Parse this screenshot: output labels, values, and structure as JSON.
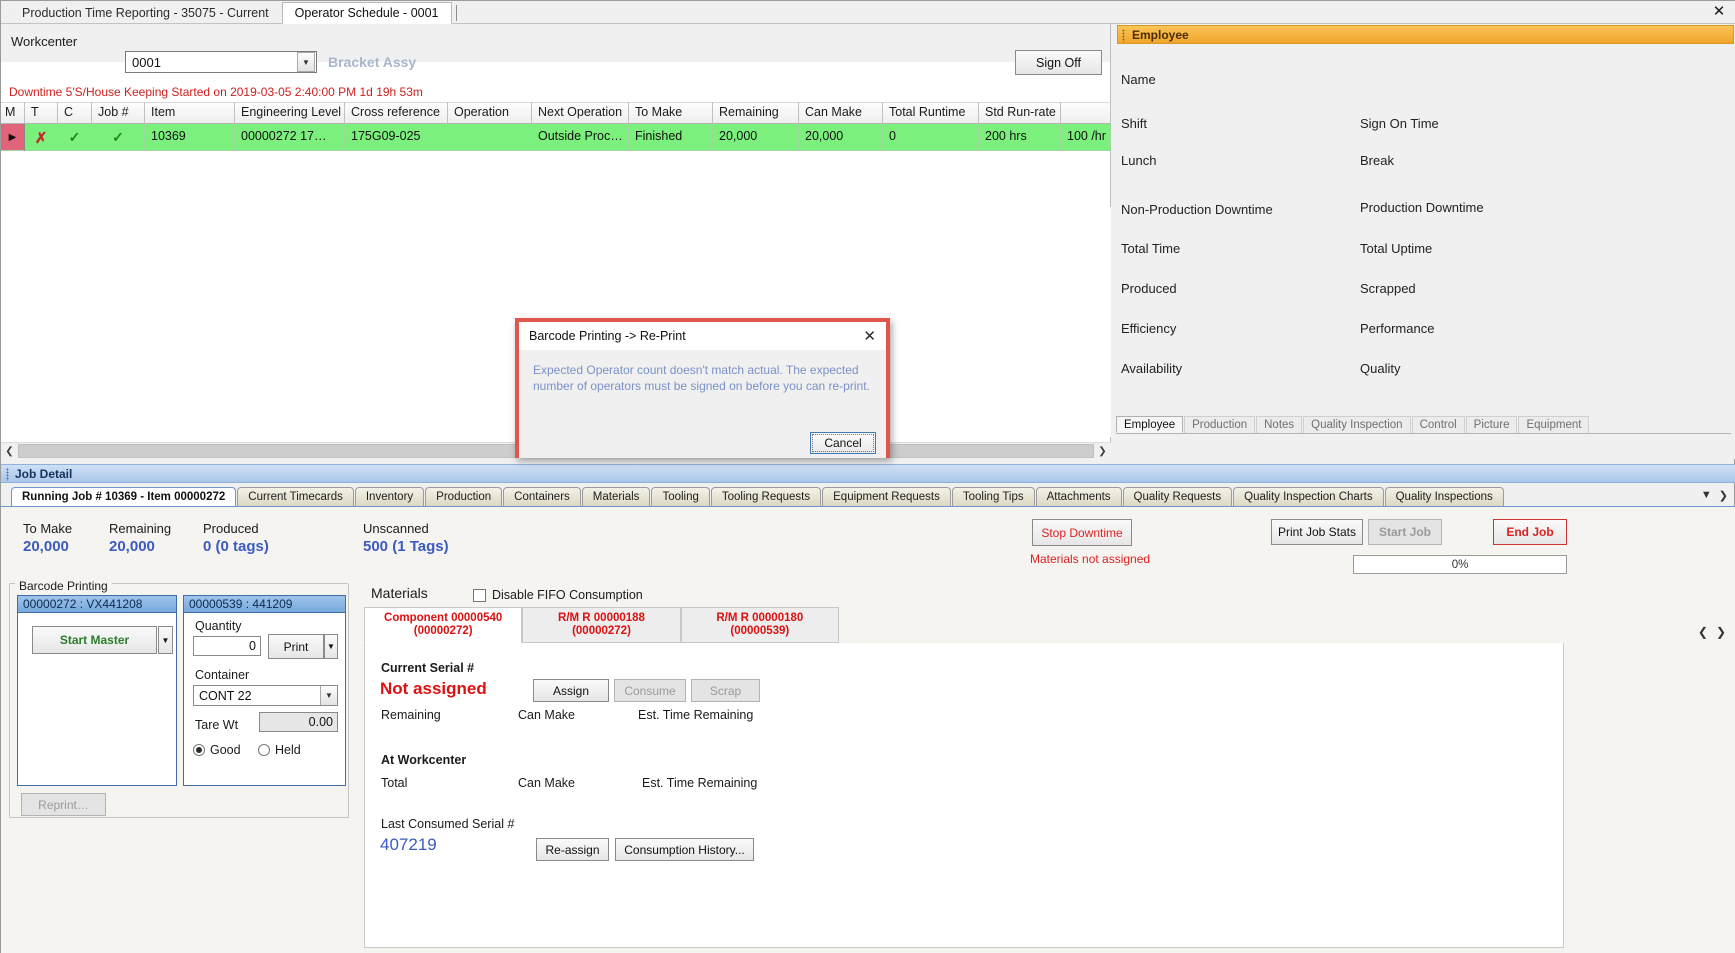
{
  "window": {
    "close_icon": "close-icon",
    "tabs": [
      {
        "label": "Production Time Reporting - 35075 - Current",
        "active": false
      },
      {
        "label": "Operator Schedule - 0001",
        "active": true
      }
    ]
  },
  "workcenter": {
    "label": "Workcenter",
    "value": "0001",
    "description": "Bracket Assy",
    "sign_off_label": "Sign Off",
    "downtime_message": "Downtime 5'S/House Keeping Started on 2019-03-05 2:40:00 PM 1d 19h 53m"
  },
  "schedule_grid": {
    "columns": [
      "M",
      "T",
      "C",
      "Job #",
      "Item",
      "Engineering Level",
      "Cross reference",
      "Operation",
      "Next Operation",
      "To Make",
      "Remaining",
      "Can Make",
      "Total Runtime",
      "Std Run-rate"
    ],
    "rows": [
      {
        "selected": true,
        "m": "x-icon",
        "t": "check-icon",
        "c": "check-icon",
        "job": "10369",
        "item": "00000272  17…",
        "engineering_level": "175G09-025",
        "cross_reference": "",
        "operation": "Outside  Proc…",
        "next_operation": "Finished",
        "to_make": "20,000",
        "remaining": "20,000",
        "can_make": "0",
        "total_runtime": "200 hrs",
        "std_run_rate": "100 /hr"
      }
    ]
  },
  "employee_panel": {
    "header": "Employee",
    "fields_left": [
      "Name",
      "Shift",
      "Lunch",
      "Non-Production Downtime",
      "Total Time",
      "Produced",
      "Efficiency",
      "Availability"
    ],
    "fields_right": [
      "Sign On Time",
      "Break",
      "Production Downtime",
      "Total Uptime",
      "Scrapped",
      "Performance",
      "Quality"
    ],
    "tabs": [
      {
        "label": "Employee",
        "active": true
      },
      {
        "label": "Production",
        "active": false
      },
      {
        "label": "Notes",
        "active": false
      },
      {
        "label": "Quality Inspection",
        "active": false
      },
      {
        "label": "Control",
        "active": false
      },
      {
        "label": "Picture",
        "active": false
      },
      {
        "label": "Equipment",
        "active": false
      }
    ]
  },
  "dialog": {
    "title": "Barcode Printing -> Re-Print",
    "close_icon": "close-icon",
    "message": "Expected Operator count doesn't match actual. The expected number of operators must be signed on before you can re-print.",
    "cancel_label": "Cancel",
    "border_color": "#e0564d"
  },
  "job_detail": {
    "section_title": "Job Detail",
    "tabs": [
      {
        "label": "Running Job # 10369 - Item 00000272",
        "active": true
      },
      {
        "label": "Current Timecards",
        "active": false
      },
      {
        "label": "Inventory",
        "active": false
      },
      {
        "label": "Production",
        "active": false
      },
      {
        "label": "Containers",
        "active": false
      },
      {
        "label": "Materials",
        "active": false
      },
      {
        "label": "Tooling",
        "active": false
      },
      {
        "label": "Tooling Requests",
        "active": false
      },
      {
        "label": "Equipment Requests",
        "active": false
      },
      {
        "label": "Tooling Tips",
        "active": false
      },
      {
        "label": "Attachments",
        "active": false
      },
      {
        "label": "Quality Requests",
        "active": false
      },
      {
        "label": "Quality Inspection Charts",
        "active": false
      },
      {
        "label": "Quality Inspections",
        "active": false
      }
    ],
    "tabs_overflow_icons": [
      "chevron-down-icon",
      "chevron-right-icon"
    ],
    "stats": [
      {
        "label": "To Make",
        "value": "20,000"
      },
      {
        "label": "Remaining",
        "value": "20,000"
      },
      {
        "label": "Produced",
        "value": "0 (0 tags)"
      },
      {
        "label": "Unscanned",
        "value": "500 (1 Tags)"
      }
    ],
    "stop_downtime_label": "Stop Downtime",
    "materials_warning": "Materials not assigned",
    "print_job_stats_label": "Print Job Stats",
    "start_job_label": "Start Job",
    "end_job_label": "End Job",
    "progress_text": "0%"
  },
  "barcode_printing": {
    "legend": "Barcode Printing",
    "left_panel": {
      "header": "00000272 : VX441208",
      "start_master_label": "Start Master",
      "dropdown_icon": "chevron-down-icon"
    },
    "right_panel": {
      "header": "00000539 : 441209",
      "quantity_label": "Quantity",
      "quantity_value": "0",
      "print_label": "Print",
      "print_dropdown_icon": "chevron-down-icon",
      "container_label": "Container",
      "container_value": "CONT 22",
      "tare_wt_label": "Tare Wt",
      "tare_wt_value": "0.00",
      "good_label": "Good",
      "held_label": "Held",
      "selected_state": "Good"
    },
    "reprint_label": "Reprint…"
  },
  "materials": {
    "title": "Materials",
    "disable_fifo_label": "Disable FIFO Consumption",
    "disable_fifo_checked": false,
    "tabs": [
      {
        "line1": "Component 00000540",
        "line2": "(00000272)",
        "active": true
      },
      {
        "line1": "R/M R 00000188",
        "line2": "(00000272)",
        "active": false
      },
      {
        "line1": "R/M R 00000180",
        "line2": "(00000539)",
        "active": false
      }
    ],
    "nav_icons": [
      "chevron-left-icon",
      "chevron-right-icon"
    ],
    "current_serial_label": "Current Serial #",
    "current_serial_value": "Not assigned",
    "remaining_label": "Remaining",
    "can_make_label": "Can Make",
    "est_time_remaining_label": "Est. Time Remaining",
    "assign_label": "Assign",
    "consume_label": "Consume",
    "scrap_label": "Scrap",
    "at_workcenter_label": "At Workcenter",
    "total_label": "Total",
    "wc_can_make_label": "Can Make",
    "wc_est_time_label": "Est. Time Remaining",
    "last_consumed_label": "Last Consumed Serial #",
    "last_consumed_value": "407219",
    "reassign_label": "Re-assign",
    "consumption_history_label": "Consumption History..."
  }
}
